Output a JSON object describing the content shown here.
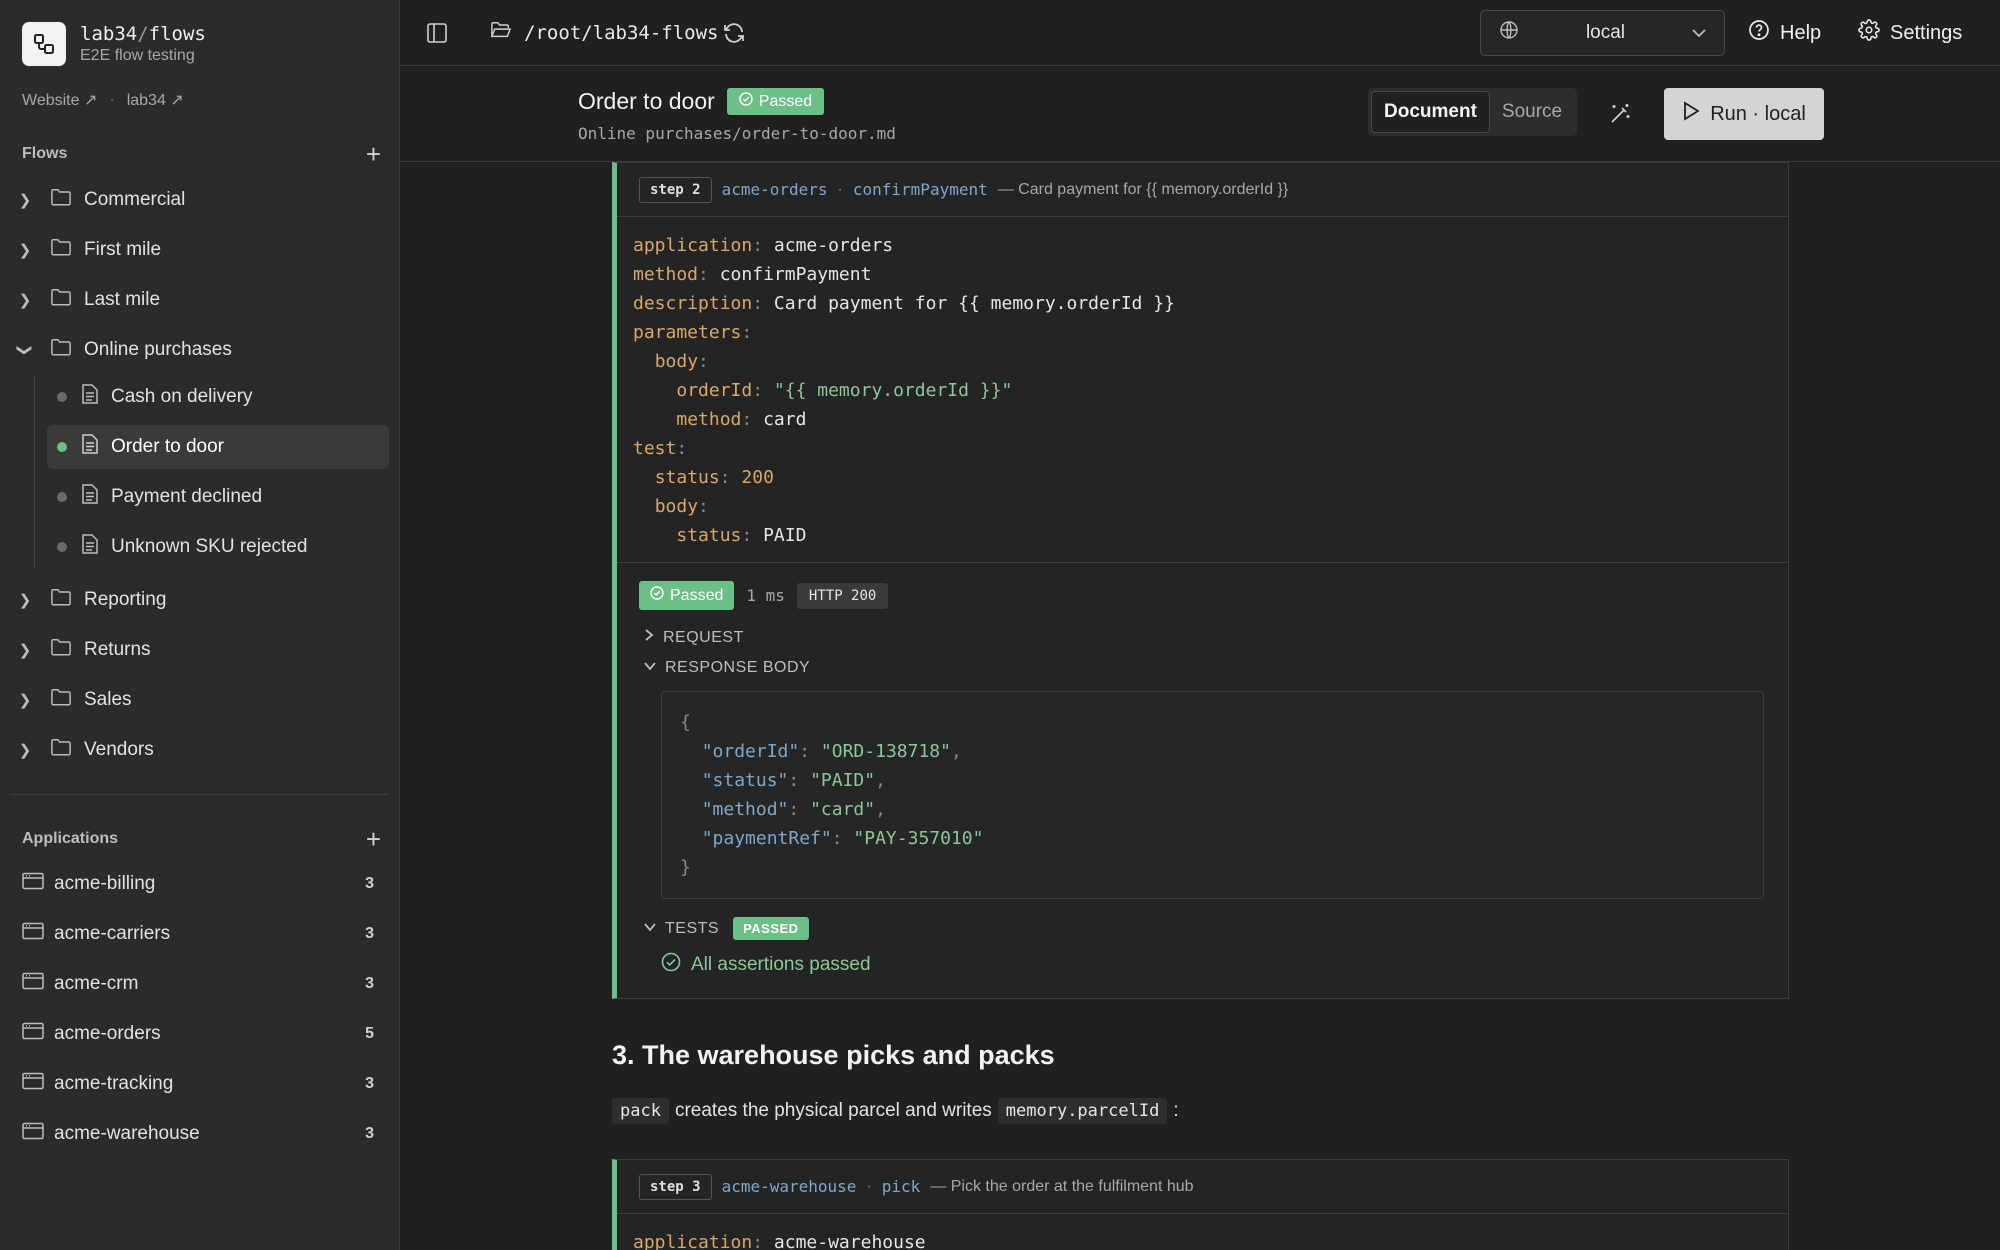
{
  "brand": {
    "name_a": "lab34",
    "name_sep": "/",
    "name_b": "flows",
    "subtitle": "E2E flow testing"
  },
  "links": [
    {
      "label": "Website"
    },
    {
      "label": "lab34"
    }
  ],
  "links_sep": "·",
  "flows_header": "Flows",
  "folders": [
    {
      "label": "Commercial",
      "expanded": false
    },
    {
      "label": "First mile",
      "expanded": false
    },
    {
      "label": "Last mile",
      "expanded": false
    },
    {
      "label": "Online purchases",
      "expanded": true
    },
    {
      "label": "Reporting",
      "expanded": false
    },
    {
      "label": "Returns",
      "expanded": false
    },
    {
      "label": "Sales",
      "expanded": false
    },
    {
      "label": "Vendors",
      "expanded": false
    }
  ],
  "flow_files": [
    {
      "label": "Cash on delivery",
      "status": "unknown"
    },
    {
      "label": "Order to door",
      "status": "passed",
      "active": true
    },
    {
      "label": "Payment declined",
      "status": "unknown"
    },
    {
      "label": "Unknown SKU rejected",
      "status": "unknown"
    }
  ],
  "applications_header": "Applications",
  "applications": [
    {
      "label": "acme-billing",
      "count": "3"
    },
    {
      "label": "acme-carriers",
      "count": "3"
    },
    {
      "label": "acme-crm",
      "count": "3"
    },
    {
      "label": "acme-orders",
      "count": "5"
    },
    {
      "label": "acme-tracking",
      "count": "3"
    },
    {
      "label": "acme-warehouse",
      "count": "3"
    }
  ],
  "topbar": {
    "path": "/root/lab34-flows",
    "env": "local",
    "help": "Help",
    "settings": "Settings"
  },
  "doc": {
    "title": "Order to door",
    "status": "Passed",
    "path": "Online purchases/order-to-door.md",
    "view_document": "Document",
    "view_source": "Source",
    "run_label": "Run · local"
  },
  "step2": {
    "pill": "step 2",
    "app": "acme-orders",
    "sep": "·",
    "method": "confirmPayment",
    "desc": "— Card payment for {{ memory.orderId }}",
    "yaml": {
      "application": "acme-orders",
      "method": "confirmPayment",
      "description": "Card payment for {{ memory.orderId }}",
      "orderId": "\"{{ memory.orderId }}\"",
      "body_method": "card",
      "status": "200",
      "body_status": "PAID"
    },
    "result": {
      "status": "Passed",
      "time": "1 ms",
      "http": "HTTP 200",
      "request_label": "REQUEST",
      "response_label": "RESPONSE BODY",
      "response": {
        "orderId": "\"ORD-138718\"",
        "status": "\"PAID\"",
        "method": "\"card\"",
        "paymentRef": "\"PAY-357010\""
      },
      "tests_label": "TESTS",
      "tests_badge": "PASSED",
      "assertions": "All assertions passed"
    }
  },
  "section3": {
    "heading": "3. The warehouse picks and packs",
    "code1": "pack",
    "text": "creates the physical parcel and writes",
    "code2": "memory.parcelId",
    "tail": ":"
  },
  "step3": {
    "pill": "step 3",
    "app": "acme-warehouse",
    "sep": "·",
    "method": "pick",
    "desc": "— Pick the order at the fulfilment hub",
    "yaml": {
      "application": "acme-warehouse"
    }
  },
  "colors": {
    "accent_green": "#6bbf87",
    "link_blue": "#7fa7cc",
    "yaml_key": "#d8a86b"
  }
}
